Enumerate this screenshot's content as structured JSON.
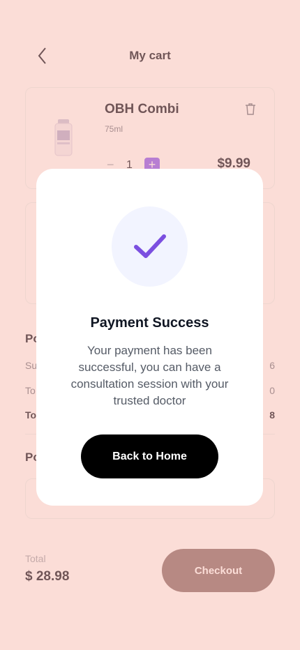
{
  "header": {
    "title": "My cart",
    "back_icon": "chevron-left-icon"
  },
  "cart_item": {
    "name": "OBH Combi",
    "size": "75ml",
    "quantity": "1",
    "minus_label": "−",
    "plus_label": "+",
    "price": "$9.99",
    "delete_icon": "trash-icon"
  },
  "payment_detail": {
    "heading": "Po",
    "rows": [
      {
        "label": "Su",
        "value": "6"
      },
      {
        "label": "To",
        "value": "0"
      },
      {
        "label": "To",
        "value": "8"
      }
    ]
  },
  "payment_method": {
    "heading": "Po"
  },
  "footer": {
    "total_label": "Total",
    "total_value": "$ 28.98",
    "checkout_label": "Checkout"
  },
  "modal": {
    "title": "Payment Success",
    "message": "Your payment has been successful, you can have a consultation session with your trusted doctor",
    "button_label": "Back to Home",
    "icon": "checkmark-icon",
    "accent": "#7B4FE0"
  },
  "colors": {
    "overlay": "#F9DCD6",
    "checkout_bg": "#CDB3B0",
    "button_bg": "#000000"
  }
}
